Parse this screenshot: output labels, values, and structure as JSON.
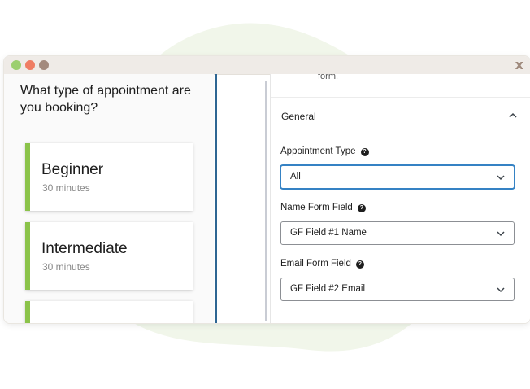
{
  "window": {
    "close_label": "x"
  },
  "booking": {
    "question": "What type of appointment are you booking?",
    "cards": [
      {
        "name": "Beginner",
        "duration": "30 minutes"
      },
      {
        "name": "Intermediate",
        "duration": "30 minutes"
      }
    ],
    "accent_color": "#8bc34a"
  },
  "settings": {
    "tail_text": "form.",
    "section_title": "General",
    "fields": [
      {
        "label": "Appointment Type",
        "value": "All"
      },
      {
        "label": "Name Form Field",
        "value": "GF Field #1 Name"
      },
      {
        "label": "Email Form Field",
        "value": "GF Field #2 Email"
      }
    ],
    "help_glyph": "?"
  },
  "colors": {
    "divider": "#2e6693",
    "focus": "#3582c4"
  }
}
